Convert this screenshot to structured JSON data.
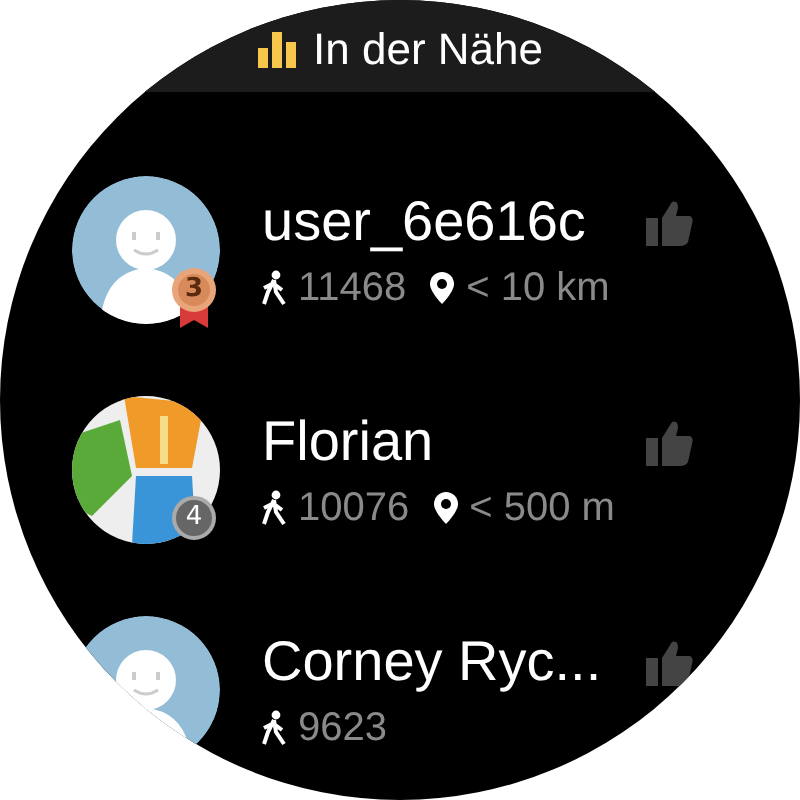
{
  "header": {
    "title": "In der Nähe"
  },
  "users": [
    {
      "name": "user_6e616c",
      "avatar": {
        "kind": "default"
      },
      "badge": {
        "kind": "medal",
        "rank": "3"
      },
      "steps": "11468",
      "distance": "< 10 km"
    },
    {
      "name": "Florian",
      "avatar": {
        "kind": "image"
      },
      "badge": {
        "kind": "plain",
        "rank": "4"
      },
      "steps": "10076",
      "distance": "< 500 m"
    },
    {
      "name": "Corney Ryc...",
      "avatar": {
        "kind": "default"
      },
      "steps": "9623"
    }
  ]
}
